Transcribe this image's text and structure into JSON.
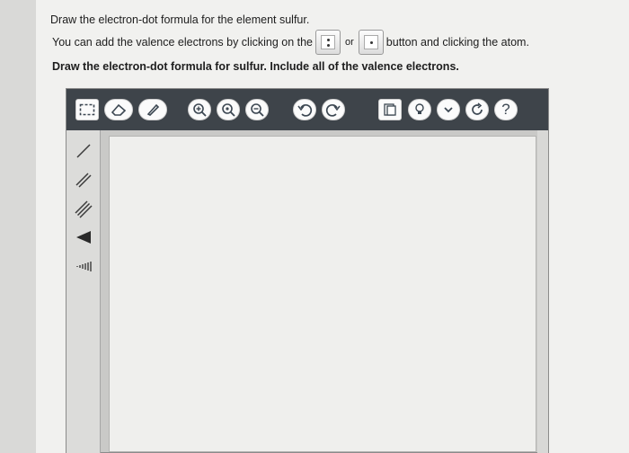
{
  "question": {
    "line1": "Draw the electron-dot formula for the element sulfur.",
    "line2_before": "You can add the valence electrons by clicking on the",
    "line2_or": "or",
    "line2_after": "button and clicking the atom.",
    "instruction": "Draw the electron-dot formula for sulfur. Include all of the valence electrons."
  },
  "toolbar": {
    "buttons": [
      {
        "name": "select-tool",
        "icon": "dashed-select-icon"
      },
      {
        "name": "erase-tool",
        "icon": "eraser-icon"
      },
      {
        "name": "pencil-tool",
        "icon": "pencil-icon"
      },
      {
        "name": "zoom-in",
        "icon": "zoom-in-icon"
      },
      {
        "name": "zoom-fit",
        "icon": "zoom-fit-icon"
      },
      {
        "name": "zoom-out",
        "icon": "zoom-out-icon"
      },
      {
        "name": "undo",
        "icon": "undo-icon"
      },
      {
        "name": "redo",
        "icon": "redo-icon"
      },
      {
        "name": "templates",
        "icon": "template-icon"
      },
      {
        "name": "tip",
        "icon": "lightbulb-icon"
      },
      {
        "name": "more",
        "icon": "chevron-down-icon"
      },
      {
        "name": "reset",
        "icon": "refresh-icon"
      },
      {
        "name": "help",
        "icon": "help-icon",
        "label": "?"
      }
    ]
  },
  "left_tools": [
    {
      "name": "single-bond",
      "icon": "single-bond-icon"
    },
    {
      "name": "double-bond",
      "icon": "double-bond-icon"
    },
    {
      "name": "triple-bond",
      "icon": "triple-bond-icon"
    },
    {
      "name": "wedge-bond",
      "icon": "wedge-bond-icon"
    },
    {
      "name": "hash-bond",
      "icon": "hash-bond-icon"
    }
  ],
  "colors": {
    "toolbar": "#3e444a",
    "button": "#fbfbfb",
    "icon": "#3c4752"
  }
}
